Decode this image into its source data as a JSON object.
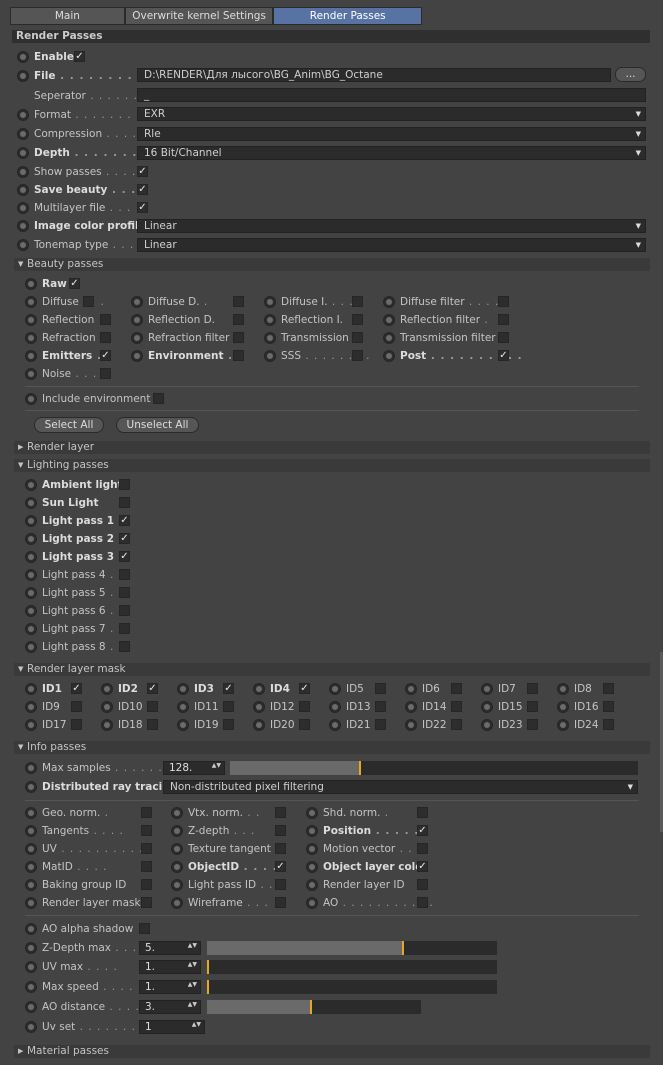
{
  "tabs": [
    "Main",
    "Overwrite kernel Settings",
    "Render Passes"
  ],
  "active_tab": 2,
  "section_title": "Render Passes",
  "enable": {
    "label": "Enable",
    "checked": true
  },
  "file": {
    "label": "File",
    "value": "D:\\RENDER\\Для лысого\\BG_Anim\\BG_Octane",
    "browse_label": "..."
  },
  "separator": {
    "label": "Seperator",
    "value": "_"
  },
  "format": {
    "label": "Format",
    "value": "EXR"
  },
  "compression": {
    "label": "Compression",
    "value": "Rle"
  },
  "depth": {
    "label": "Depth",
    "value": "16 Bit/Channel"
  },
  "show_passes": {
    "label": "Show passes",
    "checked": true
  },
  "save_beauty": {
    "label": "Save beauty",
    "checked": true
  },
  "multilayer": {
    "label": "Multilayer file",
    "checked": true
  },
  "image_color_profile": {
    "label": "Image color profile",
    "value": "Linear"
  },
  "tonemap_type": {
    "label": "Tonemap type",
    "value": "Linear"
  },
  "beauty": {
    "title": "Beauty passes",
    "raw": {
      "label": "Raw",
      "checked": true
    },
    "items": [
      {
        "label": "Diffuse",
        "checked": false
      },
      {
        "label": "Diffuse D.",
        "checked": false
      },
      {
        "label": "Diffuse I.",
        "checked": false
      },
      {
        "label": "Diffuse filter",
        "checked": false
      },
      {
        "label": "Reflection",
        "checked": false
      },
      {
        "label": "Reflection D.",
        "checked": false
      },
      {
        "label": "Reflection I.",
        "checked": false
      },
      {
        "label": "Reflection filter",
        "checked": false
      },
      {
        "label": "Refraction",
        "checked": false
      },
      {
        "label": "Refraction filter",
        "checked": false
      },
      {
        "label": "Transmission",
        "checked": false
      },
      {
        "label": "Transmission filter",
        "checked": false
      },
      {
        "label": "Emitters",
        "checked": true
      },
      {
        "label": "Environment",
        "checked": false
      },
      {
        "label": "SSS",
        "checked": false
      },
      {
        "label": "Post",
        "checked": true
      },
      {
        "label": "Noise",
        "checked": false
      }
    ],
    "include_env": {
      "label": "Include environment",
      "checked": false
    },
    "select_all": "Select All",
    "unselect_all": "Unselect All"
  },
  "render_layer": {
    "title": "Render layer"
  },
  "lighting": {
    "title": "Lighting passes",
    "items": [
      {
        "label": "Ambient light",
        "checked": false
      },
      {
        "label": "Sun Light",
        "checked": false
      },
      {
        "label": "Light pass 1",
        "checked": true
      },
      {
        "label": "Light pass 2",
        "checked": true
      },
      {
        "label": "Light pass 3",
        "checked": true
      },
      {
        "label": "Light pass 4",
        "checked": false
      },
      {
        "label": "Light pass 5",
        "checked": false
      },
      {
        "label": "Light pass 6",
        "checked": false
      },
      {
        "label": "Light pass 7",
        "checked": false
      },
      {
        "label": "Light pass 8",
        "checked": false
      }
    ]
  },
  "mask": {
    "title": "Render layer mask",
    "items": [
      {
        "label": "ID1",
        "checked": true
      },
      {
        "label": "ID2",
        "checked": true
      },
      {
        "label": "ID3",
        "checked": true
      },
      {
        "label": "ID4",
        "checked": true
      },
      {
        "label": "ID5",
        "checked": false
      },
      {
        "label": "ID6",
        "checked": false
      },
      {
        "label": "ID7",
        "checked": false
      },
      {
        "label": "ID8",
        "checked": false
      },
      {
        "label": "ID9",
        "checked": false
      },
      {
        "label": "ID10",
        "checked": false
      },
      {
        "label": "ID11",
        "checked": false
      },
      {
        "label": "ID12",
        "checked": false
      },
      {
        "label": "ID13",
        "checked": false
      },
      {
        "label": "ID14",
        "checked": false
      },
      {
        "label": "ID15",
        "checked": false
      },
      {
        "label": "ID16",
        "checked": false
      },
      {
        "label": "ID17",
        "checked": false
      },
      {
        "label": "ID18",
        "checked": false
      },
      {
        "label": "ID19",
        "checked": false
      },
      {
        "label": "ID20",
        "checked": false
      },
      {
        "label": "ID21",
        "checked": false
      },
      {
        "label": "ID22",
        "checked": false
      },
      {
        "label": "ID23",
        "checked": false
      },
      {
        "label": "ID24",
        "checked": false
      }
    ]
  },
  "info": {
    "title": "Info passes",
    "max_samples": {
      "label": "Max samples",
      "value": "128.",
      "fraction": 0.32
    },
    "distributed": {
      "label": "Distributed ray tracing",
      "value": "Non-distributed pixel filtering"
    },
    "items": [
      {
        "label": "Geo. norm.",
        "checked": false
      },
      {
        "label": "Vtx. norm.",
        "checked": false
      },
      {
        "label": "Shd. norm.",
        "checked": false
      },
      {
        "label": "Tangents",
        "checked": false
      },
      {
        "label": "Z-depth",
        "checked": false
      },
      {
        "label": "Position",
        "checked": true
      },
      {
        "label": "UV",
        "checked": false
      },
      {
        "label": "Texture tangent",
        "checked": false
      },
      {
        "label": "Motion vector",
        "checked": false
      },
      {
        "label": "MatID",
        "checked": false
      },
      {
        "label": "ObjectID",
        "checked": true
      },
      {
        "label": "Object layer color",
        "checked": true
      },
      {
        "label": "Baking group ID",
        "checked": false
      },
      {
        "label": "Light pass ID",
        "checked": false
      },
      {
        "label": "Render layer ID",
        "checked": false
      },
      {
        "label": "Render layer mask",
        "checked": false
      },
      {
        "label": "Wireframe",
        "checked": false
      },
      {
        "label": "AO",
        "checked": false
      }
    ],
    "ao_alpha": {
      "label": "AO alpha shadow",
      "checked": false
    },
    "zdepth_max": {
      "label": "Z-Depth max",
      "value": "5.",
      "fraction": 0.68
    },
    "uv_max": {
      "label": "UV max",
      "value": "1.",
      "fraction": 0.0
    },
    "max_speed": {
      "label": "Max speed",
      "value": "1.",
      "fraction": 0.0
    },
    "ao_distance": {
      "label": "AO distance",
      "value": "3.",
      "fraction": 0.49
    },
    "uv_set": {
      "label": "Uv set",
      "value": "1"
    }
  },
  "material": {
    "title": "Material passes"
  }
}
